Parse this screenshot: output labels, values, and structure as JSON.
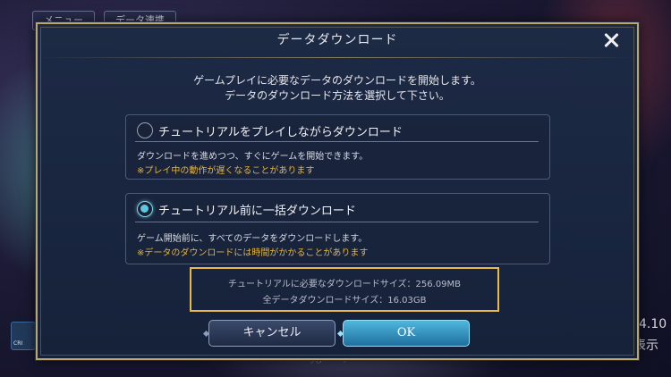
{
  "background": {
    "tabs": [
      "メニュー",
      "データ連携"
    ],
    "badge_label": "CRI",
    "version_partial": "4.10",
    "display_partial": "表示",
    "copyright": "©Cygames, Inc."
  },
  "dialog": {
    "title": "データダウンロード",
    "intro_line1": "ゲームプレイに必要なデータのダウンロードを開始します。",
    "intro_line2": "データのダウンロード方法を選択して下さい。",
    "options": [
      {
        "label": "チュートリアルをプレイしながらダウンロード",
        "description": "ダウンロードを進めつつ、すぐにゲームを開始できます。",
        "note": "※プレイ中の動作が遅くなることがあります",
        "selected": false
      },
      {
        "label": "チュートリアル前に一括ダウンロード",
        "description": "ゲーム開始前に、すべてのデータをダウンロードします。",
        "note": "※データのダウンロードには時間がかかることがあります",
        "selected": true
      }
    ],
    "size_tutorial": "チュートリアルに必要なダウンロードサイズ：256.09MB",
    "size_all": "全データダウンロードサイズ：16.03GB",
    "cancel_label": "キャンセル",
    "ok_label": "OK"
  },
  "colors": {
    "frame_gold": "#b9a670",
    "highlight_box": "#e9b94a",
    "note_orange": "#e6b23a",
    "ok_button": "#3aa7d2",
    "selected_radio": "#5cc8e0"
  },
  "icons": [
    "close-icon",
    "radio-unselected",
    "radio-selected"
  ]
}
